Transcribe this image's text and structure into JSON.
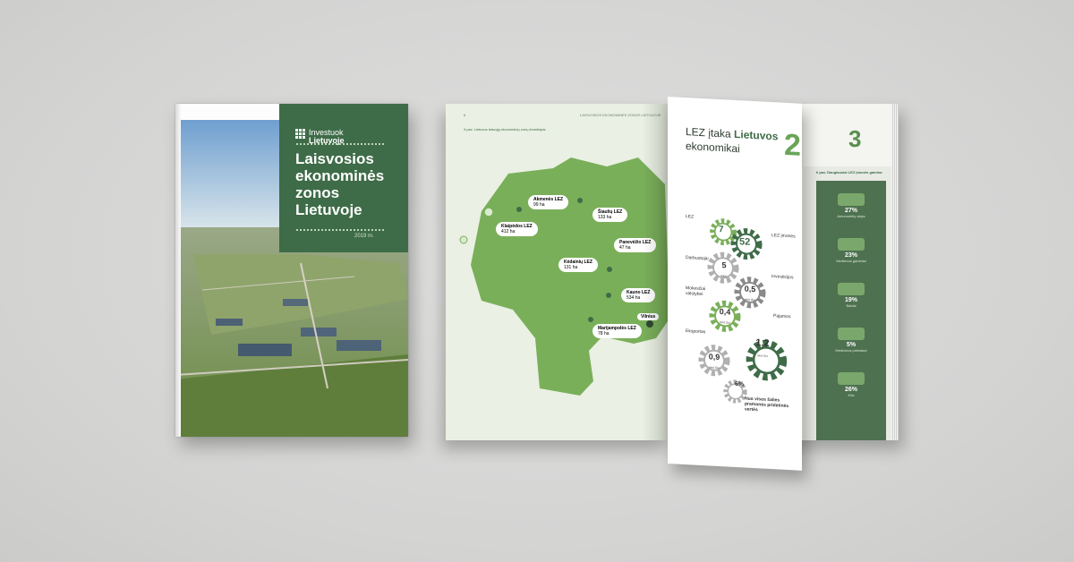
{
  "cover": {
    "logo_top": "Investuok",
    "logo_bottom": "Lietuvoje",
    "title": "Laisvosios ekonominės zonos Lietuvoje",
    "year": "2019 m."
  },
  "left_page": {
    "caption": "3 pav. Lietuvos laisvųjų ekonominių zonų žemėlapis",
    "header": "LAISVOSIOS EKONOMINĖS ZONOS LIETUVOJE",
    "page_number": "6",
    "zones": [
      {
        "name": "Akmenės LEZ",
        "area": "99"
      },
      {
        "name": "Šiaulių LEZ",
        "area": "133"
      },
      {
        "name": "Klaipėdos LEZ",
        "area": "412"
      },
      {
        "name": "Panevėžio LEZ",
        "area": "47"
      },
      {
        "name": "Kėdainių LEZ",
        "area": "131"
      },
      {
        "name": "Kauno LEZ",
        "area": "534"
      },
      {
        "name": "Marijampolės LEZ",
        "area": "78"
      }
    ],
    "city": "Vilnius",
    "area_unit": "ha"
  },
  "turning_page": {
    "title_plain": "LEZ įtaka",
    "title_bold": "Lietuvos",
    "title_line2": "ekonomikai",
    "section_number": "2",
    "gears": [
      {
        "value": "7",
        "unit": ""
      },
      {
        "value": "52",
        "unit": ""
      },
      {
        "value": "5",
        "unit": "tūkst."
      },
      {
        "value": "0,5",
        "unit": "mlrd. Eur"
      },
      {
        "value": "0,4",
        "unit": "mlrd. Eur"
      },
      {
        "value": "1,2",
        "unit": "mlrd. Eur"
      },
      {
        "value": "0,9",
        "unit": "mlrd. Eur"
      },
      {
        "value": "6",
        "unit": "%"
      }
    ],
    "labels": {
      "lez": "LEZ",
      "lez_imones": "LEZ įmonės",
      "darbuotojai": "Darbuotojai",
      "investicijos": "Investicijos",
      "mokesciai": "Mokesčiai valstybei",
      "pajamos": "Pajamos",
      "eksportas": "Eksportas",
      "footer": "Nuo visos šalies pramonės pridėtinės vertės"
    }
  },
  "right_page": {
    "section_number": "3",
    "caption": "6 pav. Daugiausiai LEZ įmonės gamina",
    "items": [
      {
        "value": "27",
        "name": "Automobilių dalys"
      },
      {
        "value": "23",
        "name": "Medienos gaminiai"
      },
      {
        "value": "19",
        "name": "Baldai"
      },
      {
        "value": "5",
        "name": "Medicinos prietaisai"
      },
      {
        "value": "26",
        "name": "Kita"
      }
    ],
    "value_unit": "%"
  },
  "colors": {
    "brand_green": "#3e6c48",
    "map_green": "#7aaf5a",
    "accent_green": "#6aa55a"
  }
}
